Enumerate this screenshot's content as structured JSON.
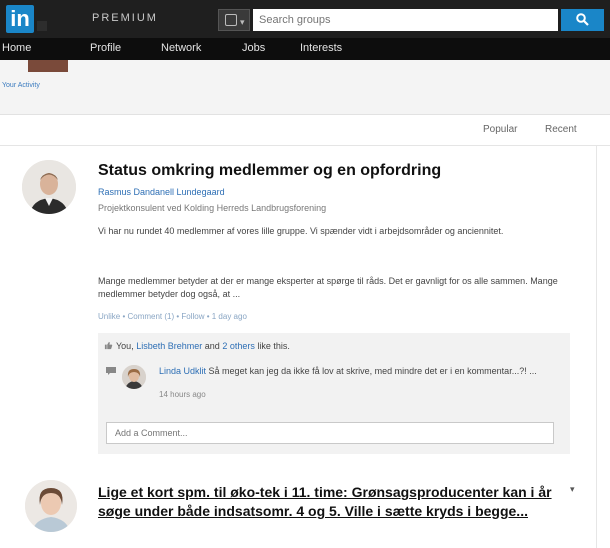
{
  "header": {
    "logo_text": "in",
    "premium_label": "PREMIUM",
    "search_placeholder": "Search groups",
    "colors": {
      "brand": "#1a86c8",
      "topbar": "#1f1f1f",
      "navbar": "#0d0d0d"
    }
  },
  "nav": {
    "items": [
      {
        "label": "Home"
      },
      {
        "label": "Profile"
      },
      {
        "label": "Network"
      },
      {
        "label": "Jobs"
      },
      {
        "label": "Interests"
      }
    ]
  },
  "activity": {
    "label": "Your Activity"
  },
  "sort": {
    "popular": "Popular",
    "recent": "Recent"
  },
  "post1": {
    "title": "Status omkring medlemmer og en opfordring",
    "author": "Rasmus Dandanell Lundegaard",
    "role": "Projektkonsulent ved Kolding Herreds Landbrugsforening",
    "paragraph1": "Vi har nu rundet 40 medlemmer af vores lille gruppe. Vi spænder vidt i arbejdsområder og anciennitet.",
    "paragraph2": "Mange medlemmer betyder at der er mange eksperter at spørge til råds. Det er gavnligt for os alle sammen. Mange medlemmer betyder dog også, at ...",
    "meta": "Unlike • Comment (1) • Follow • 1 day ago",
    "likes": {
      "you": "You,",
      "person": "Lisbeth Brehmer",
      "and": "and",
      "others": "2 others",
      "suffix": "like this."
    },
    "comment": {
      "author": "Linda Udklit",
      "text": "Så meget kan jeg da ikke få lov at skrive, med mindre det er i en kommentar...?! ...",
      "time": "14 hours ago"
    },
    "add_comment_placeholder": "Add a Comment..."
  },
  "post2": {
    "title": "Lige et kort spm. til øko-tek i 11. time: Grønsagsproducenter kan i år søge under både indsatsomr. 4 og 5. Ville i sætte kryds i begge..."
  }
}
